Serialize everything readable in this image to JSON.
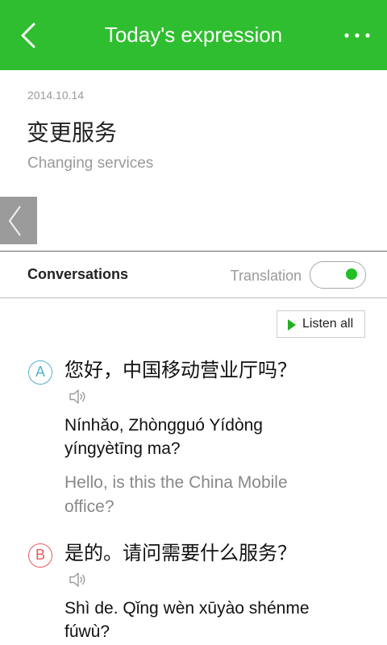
{
  "header": {
    "title": "Today's expression",
    "back_icon": "chevron-left-icon",
    "menu_icon": "more-horizontal-icon",
    "color": "#2fbe2f"
  },
  "expression": {
    "date": "2014.10.14",
    "chinese": "变更服务",
    "english": "Changing services"
  },
  "side_tab": {
    "icon": "chevron-left-icon"
  },
  "conversations": {
    "heading": "Conversations",
    "translation_label": "Translation",
    "translation_on": true,
    "listen_all_label": "Listen all",
    "listen_all_icon": "play-icon"
  },
  "dialogue": [
    {
      "speaker": "A",
      "color": "#4fb3c8",
      "chinese": "您好，中国移动营业厅吗？",
      "audio_icon": "speaker-icon",
      "pinyin": "Nínhǎo, Zhòngguó Yídòng yíngyètīng ma?",
      "translation": "Hello, is this the China Mobile office?"
    },
    {
      "speaker": "B",
      "color": "#e85a5f",
      "chinese": "是的。请问需要什么服务？",
      "audio_icon": "speaker-icon",
      "pinyin": "Shì de. Qǐng wèn xūyào shénme fúwù?"
    }
  ]
}
